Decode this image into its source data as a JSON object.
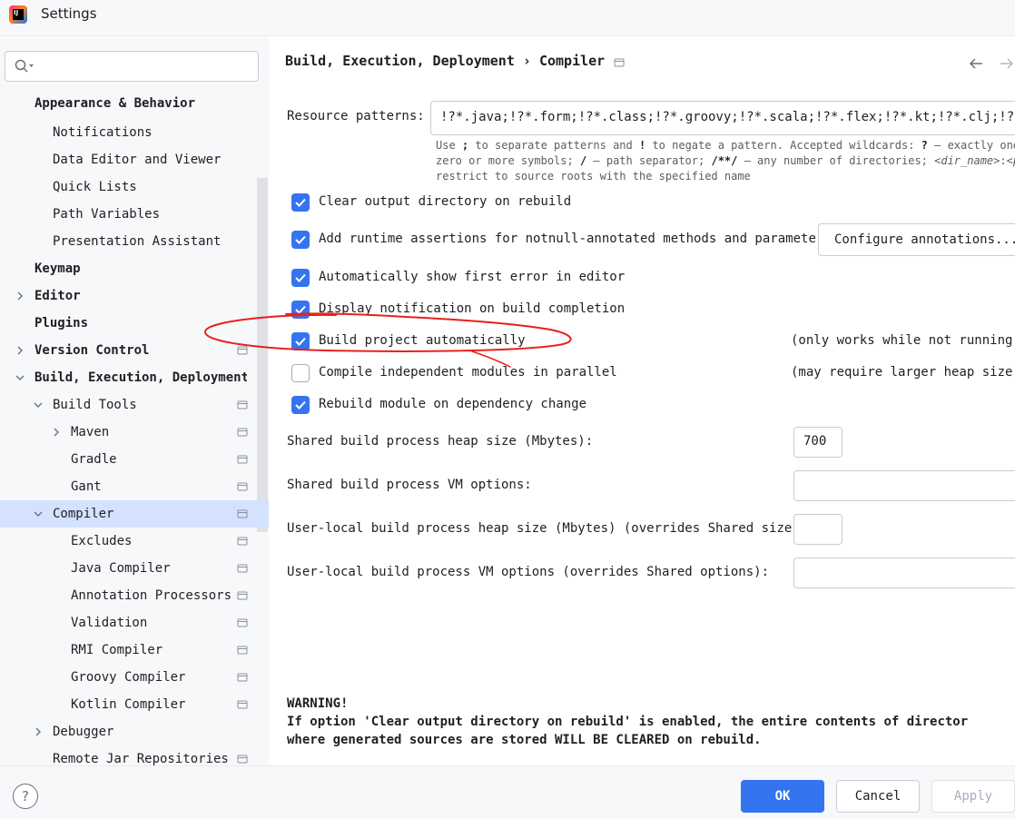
{
  "window": {
    "title": "Settings",
    "app_icon_text": "IJ"
  },
  "sidebar": {
    "search_placeholder": "",
    "items": [
      {
        "label": "Appearance & Behavior",
        "bold": true
      },
      {
        "label": "Notifications"
      },
      {
        "label": "Data Editor and Viewer"
      },
      {
        "label": "Quick Lists"
      },
      {
        "label": "Path Variables"
      },
      {
        "label": "Presentation Assistant"
      },
      {
        "label": "Keymap",
        "bold": true
      },
      {
        "label": "Editor",
        "bold": true
      },
      {
        "label": "Plugins",
        "bold": true
      },
      {
        "label": "Version Control",
        "bold": true
      },
      {
        "label": "Build, Execution, Deployment",
        "bold": true
      },
      {
        "label": "Build Tools"
      },
      {
        "label": "Maven"
      },
      {
        "label": "Gradle"
      },
      {
        "label": "Gant"
      },
      {
        "label": "Compiler",
        "selected": true
      },
      {
        "label": "Excludes"
      },
      {
        "label": "Java Compiler"
      },
      {
        "label": "Annotation Processors"
      },
      {
        "label": "Validation"
      },
      {
        "label": "RMI Compiler"
      },
      {
        "label": "Groovy Compiler"
      },
      {
        "label": "Kotlin Compiler"
      },
      {
        "label": "Debugger"
      },
      {
        "label": "Remote Jar Repositories"
      }
    ]
  },
  "breadcrumb": {
    "parent": "Build, Execution, Deployment",
    "separator": "›",
    "current": "Compiler"
  },
  "resource_patterns": {
    "label": "Resource patterns:",
    "value": "!?*.java;!?*.form;!?*.class;!?*.groovy;!?*.scala;!?*.flex;!?*.kt;!?*.clj;!?*.aj",
    "hint_line1_a": "Use ",
    "hint_semicolon": ";",
    "hint_line1_b": " to separate patterns and ",
    "hint_bang": "!",
    "hint_line1_c": " to negate a pattern. Accepted wildcards: ",
    "hint_q": "?",
    "hint_line1_d": " — exactly one s",
    "hint_line2_a": "zero or more symbols; ",
    "hint_slash": "/",
    "hint_line2_b": " — path separator; ",
    "hint_globstar": "/**/",
    "hint_line2_c": " — any number of directories; ",
    "hint_dirname": "<dir_name>",
    "hint_line2_d": ":",
    "hint_pa": "<pa",
    "hint_line3": "restrict to source roots with the specified name"
  },
  "options": {
    "clear_output": {
      "label": "Clear output directory on rebuild",
      "checked": true
    },
    "runtime_assertions": {
      "label": "Add runtime assertions for notnull-annotated methods and parameters",
      "checked": true
    },
    "configure_annotations": "Configure annotations...",
    "show_first_error": {
      "label": "Automatically show first error in editor",
      "checked": true
    },
    "display_notification": {
      "label": "Display notification on build completion",
      "checked": true
    },
    "build_automatically": {
      "label": "Build project automatically",
      "checked": true,
      "note": "(only works while not running /"
    },
    "compile_parallel": {
      "label": "Compile independent modules in parallel",
      "checked": false,
      "note": "(may require larger heap size)"
    },
    "rebuild_on_dependency": {
      "label": "Rebuild module on dependency change",
      "checked": true
    }
  },
  "fields": {
    "shared_heap": {
      "label": "Shared build process heap size (Mbytes):",
      "value": "700"
    },
    "shared_vm": {
      "label": "Shared build process VM options:",
      "value": ""
    },
    "local_heap": {
      "label": "User-local build process heap size (Mbytes) (overrides Shared size):",
      "value": ""
    },
    "local_vm": {
      "label": "User-local build process VM options (overrides Shared options):",
      "value": ""
    }
  },
  "warning": {
    "title": "WARNING!",
    "line1": "If option 'Clear output directory on rebuild' is enabled, the entire contents of director",
    "line2": "where generated sources are stored WILL BE CLEARED on rebuild."
  },
  "footer": {
    "help": "?",
    "ok": "OK",
    "cancel": "Cancel",
    "apply": "Apply"
  },
  "colors": {
    "accent": "#3574f0",
    "selection": "#d4e2ff",
    "annotation": "#e8201c"
  }
}
